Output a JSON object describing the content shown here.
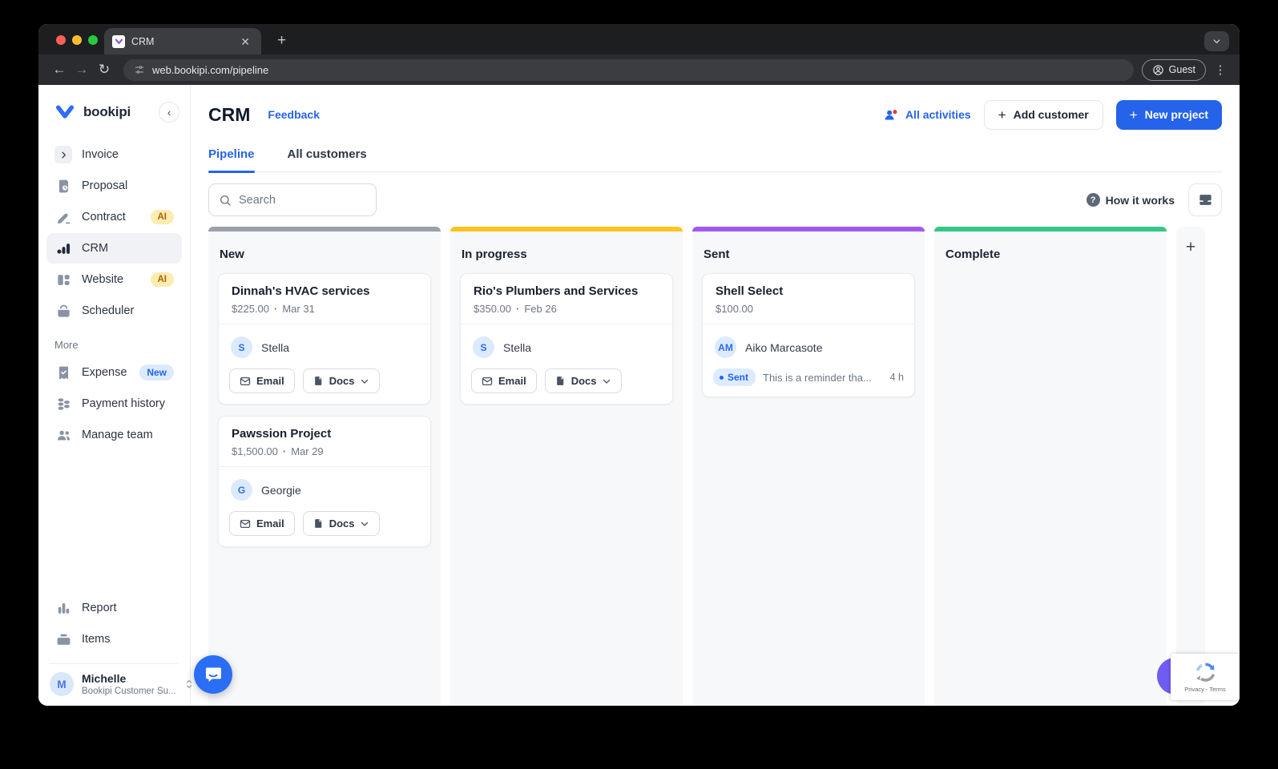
{
  "browser": {
    "tab_title": "CRM",
    "url": "web.bookipi.com/pipeline",
    "profile_label": "Guest"
  },
  "sidebar": {
    "brand": "bookipi",
    "items": [
      {
        "label": "Invoice",
        "icon": "invoice"
      },
      {
        "label": "Proposal",
        "icon": "proposal"
      },
      {
        "label": "Contract",
        "icon": "contract",
        "badge": "AI",
        "badge_type": "ai"
      },
      {
        "label": "CRM",
        "icon": "crm",
        "active": true
      },
      {
        "label": "Website",
        "icon": "website",
        "badge": "AI",
        "badge_type": "ai"
      },
      {
        "label": "Scheduler",
        "icon": "scheduler"
      }
    ],
    "more_label": "More",
    "more_items": [
      {
        "label": "Expense",
        "icon": "expense",
        "badge": "New",
        "badge_type": "new"
      },
      {
        "label": "Payment history",
        "icon": "payment-history"
      },
      {
        "label": "Manage team",
        "icon": "manage-team"
      }
    ],
    "bottom_items": [
      {
        "label": "Report",
        "icon": "report"
      },
      {
        "label": "Items",
        "icon": "items"
      }
    ],
    "user": {
      "initials": "M",
      "name": "Michelle",
      "role": "Bookipi Customer Su..."
    }
  },
  "header": {
    "title": "CRM",
    "feedback": "Feedback",
    "all_activities": "All activities",
    "add_customer": "Add customer",
    "new_project": "New project"
  },
  "tabs": [
    {
      "label": "Pipeline",
      "active": true
    },
    {
      "label": "All customers",
      "active": false
    }
  ],
  "board_toolbar": {
    "search_placeholder": "Search",
    "how_it_works": "How it works"
  },
  "board": {
    "columns": [
      {
        "name": "New",
        "color": "#9aa1ab",
        "cards": [
          {
            "title": "Dinnah's HVAC services",
            "amount": "$225.00",
            "date": "Mar 31",
            "contact": {
              "initials": "S",
              "name": "Stella"
            },
            "actions": {
              "email": "Email",
              "docs": "Docs"
            }
          },
          {
            "title": "Pawssion Project",
            "amount": "$1,500.00",
            "date": "Mar 29",
            "contact": {
              "initials": "G",
              "name": "Georgie"
            },
            "actions": {
              "email": "Email",
              "docs": "Docs"
            }
          }
        ]
      },
      {
        "name": "In progress",
        "color": "#fdc321",
        "cards": [
          {
            "title": "Rio's Plumbers and Services",
            "amount": "$350.00",
            "date": "Feb 26",
            "contact": {
              "initials": "S",
              "name": "Stella"
            },
            "actions": {
              "email": "Email",
              "docs": "Docs"
            }
          }
        ]
      },
      {
        "name": "Sent",
        "color": "#a158f2",
        "cards": [
          {
            "title": "Shell Select",
            "amount": "$100.00",
            "contact": {
              "initials": "AM",
              "name": "Aiko Marcasote"
            },
            "activity": {
              "status": "Sent",
              "message": "This is a reminder tha...",
              "time": "4 h"
            }
          }
        ]
      },
      {
        "name": "Complete",
        "color": "#35c789",
        "cards": []
      }
    ]
  },
  "recaptcha": {
    "text": "Privacy - Terms"
  },
  "colors": {
    "accent": "#2563eb",
    "column_new": "#9aa1ab",
    "column_in_progress": "#fdc321",
    "column_sent": "#a158f2",
    "column_complete": "#35c789"
  }
}
